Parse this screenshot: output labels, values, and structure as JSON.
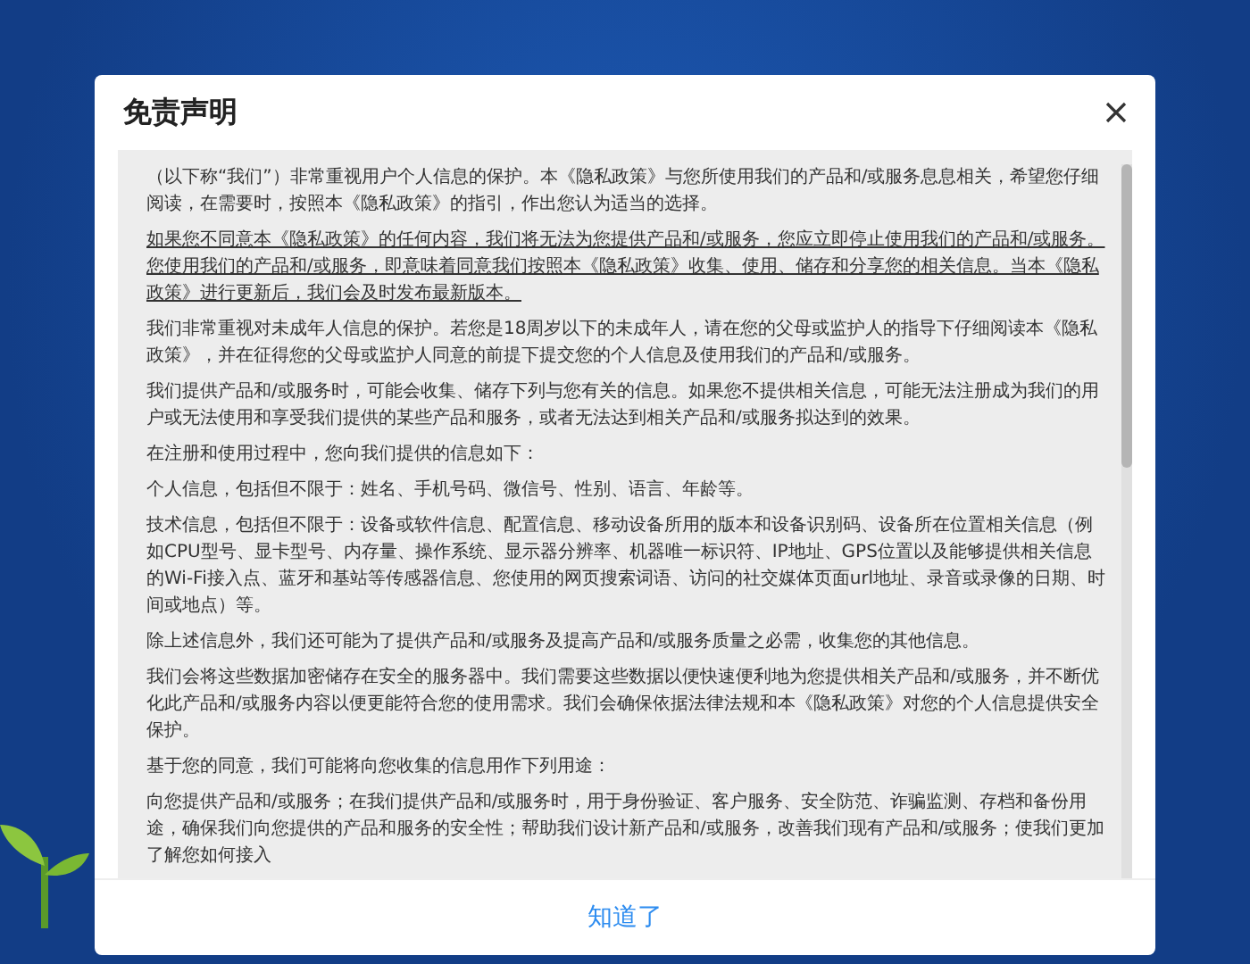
{
  "dialog": {
    "title": "免责声明",
    "paragraphs": [
      {
        "kind": "plain",
        "text": "（以下称“我们”）非常重视用户个人信息的保护。本《隐私政策》与您所使用我们的产品和/或服务息息相关，希望您仔细阅读，在需要时，按照本《隐私政策》的指引，作出您认为适当的选择。"
      },
      {
        "kind": "underlined",
        "text": "如果您不同意本《隐私政策》的任何内容，我们将无法为您提供产品和/或服务，您应立即停止使用我们的产品和/或服务。您使用我们的产品和/或服务，即意味着同意我们按照本《隐私政策》收集、使用、储存和分享您的相关信息。当本《隐私政策》进行更新后，我们会及时发布最新版本。"
      },
      {
        "kind": "plain",
        "text": "我们非常重视对未成年人信息的保护。若您是18周岁以下的未成年人，请在您的父母或监护人的指导下仔细阅读本《隐私政策》，并在征得您的父母或监护人同意的前提下提交您的个人信息及使用我们的产品和/或服务。"
      },
      {
        "kind": "plain",
        "text": "我们提供产品和/或服务时，可能会收集、储存下列与您有关的信息。如果您不提供相关信息，可能无法注册成为我们的用户或无法使用和享受我们提供的某些产品和服务，或者无法达到相关产品和/或服务拟达到的效果。"
      },
      {
        "kind": "plain",
        "text": "在注册和使用过程中，您向我们提供的信息如下："
      },
      {
        "kind": "plain",
        "text": "个人信息，包括但不限于：姓名、手机号码、微信号、性别、语言、年龄等。"
      },
      {
        "kind": "plain",
        "text": "技术信息，包括但不限于：设备或软件信息、配置信息、移动设备所用的版本和设备识别码、设备所在位置相关信息（例如CPU型号、显卡型号、内存量、操作系统、显示器分辨率、机器唯一标识符、IP地址、GPS位置以及能够提供相关信息的Wi-Fi接入点、蓝牙和基站等传感器信息、您使用的网页搜索词语、访问的社交媒体页面url地址、录音或录像的日期、时间或地点）等。"
      },
      {
        "kind": "plain",
        "text": "除上述信息外，我们还可能为了提供产品和/或服务及提高产品和/或服务质量之必需，收集您的其他信息。"
      },
      {
        "kind": "plain",
        "text": "我们会将这些数据加密储存在安全的服务器中。我们需要这些数据以便快速便利地为您提供相关产品和/或服务，并不断优化此产品和/或服务内容以便更能符合您的使用需求。我们会确保依据法律法规和本《隐私政策》对您的个人信息提供安全保护。"
      },
      {
        "kind": "plain",
        "text": "基于您的同意，我们可能将向您收集的信息用作下列用途："
      },
      {
        "kind": "plain",
        "text": "向您提供产品和/或服务；在我们提供产品和/或服务时，用于身份验证、客户服务、安全防范、诈骗监测、存档和备份用途，确保我们向您提供的产品和服务的安全性；帮助我们设计新产品和/或服务，改善我们现有产品和/或服务；使我们更加了解您如何接入"
      }
    ],
    "confirm_button": "知道了"
  }
}
